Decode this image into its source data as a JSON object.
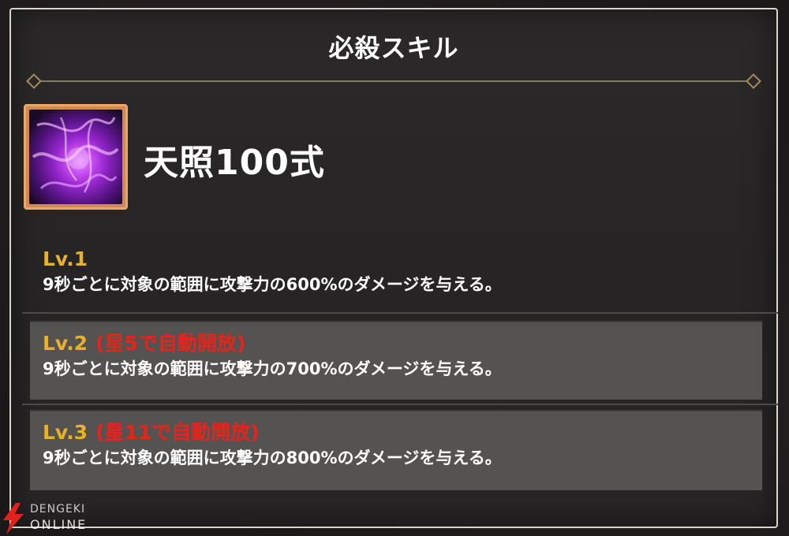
{
  "dialog": {
    "title": "必殺スキル"
  },
  "skill": {
    "icon": "purple-flame-skill-icon",
    "name": "天照100式"
  },
  "levels": [
    {
      "label": "Lv.1",
      "unlock": "",
      "description": "9秒ごとに対象の範囲に攻撃力の600%のダメージを与える。"
    },
    {
      "label": "Lv.2",
      "unlock": "(星5で自動開放)",
      "description": "9秒ごとに対象の範囲に攻撃力の700%のダメージを与える。"
    },
    {
      "label": "Lv.3",
      "unlock": "(星11で自動開放)",
      "description": "9秒ごとに対象の範囲に攻撃力の800%のダメージを与える。"
    }
  ],
  "watermark": {
    "top": "DENGEKI",
    "bottom": "ONLINE"
  },
  "colors": {
    "level_label": "#e6b12c",
    "unlock_text": "#e8231c",
    "panel_border": "#d9d4cc",
    "divider": "#8a7c52",
    "icon_frame": "#e9a869"
  }
}
